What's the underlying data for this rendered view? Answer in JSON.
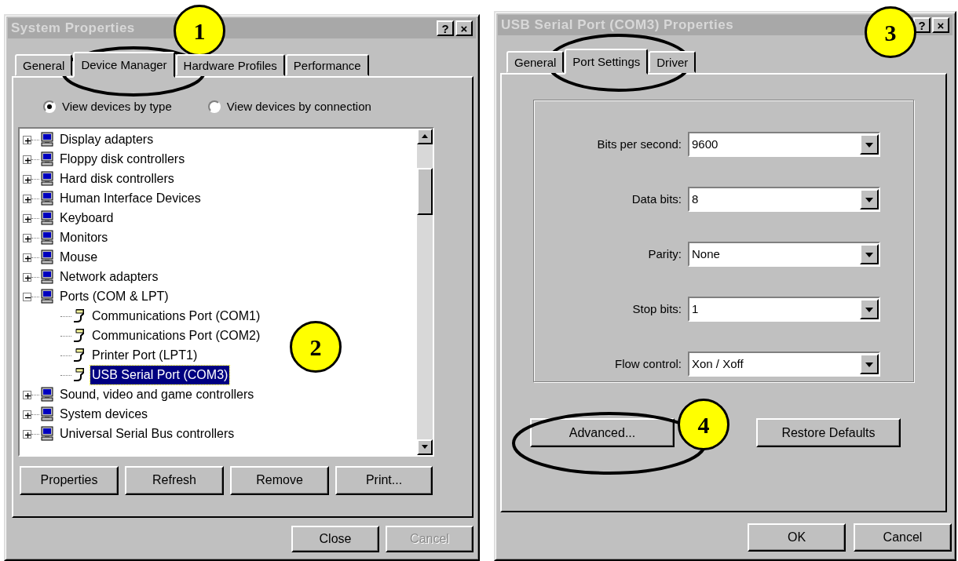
{
  "system_properties": {
    "title": "System Properties",
    "title_buttons": [
      "?",
      "×"
    ],
    "tabs": [
      {
        "label": "General",
        "selected": false
      },
      {
        "label": "Device Manager",
        "selected": true
      },
      {
        "label": "Hardware Profiles",
        "selected": false
      },
      {
        "label": "Performance",
        "selected": false
      }
    ],
    "view_options": [
      {
        "label": "View devices by type",
        "selected": true
      },
      {
        "label": "View devices by connection",
        "selected": false
      }
    ],
    "device_tree": [
      {
        "label": "Display adapters",
        "expanded": false,
        "selected": false
      },
      {
        "label": "Floppy disk controllers",
        "expanded": false,
        "selected": false
      },
      {
        "label": "Hard disk controllers",
        "expanded": false,
        "selected": false
      },
      {
        "label": "Human Interface Devices",
        "expanded": false,
        "selected": false
      },
      {
        "label": "Keyboard",
        "expanded": false,
        "selected": false
      },
      {
        "label": "Monitors",
        "expanded": false,
        "selected": false
      },
      {
        "label": "Mouse",
        "expanded": false,
        "selected": false
      },
      {
        "label": "Network adapters",
        "expanded": false,
        "selected": false
      },
      {
        "label": "Ports (COM & LPT)",
        "expanded": true,
        "selected": false,
        "children": [
          {
            "label": "Communications Port (COM1)",
            "selected": false
          },
          {
            "label": "Communications Port (COM2)",
            "selected": false
          },
          {
            "label": "Printer Port (LPT1)",
            "selected": false
          },
          {
            "label": "USB Serial Port (COM3)",
            "selected": true
          }
        ]
      },
      {
        "label": "Sound, video and game controllers",
        "expanded": false,
        "selected": false
      },
      {
        "label": "System devices",
        "expanded": false,
        "selected": false
      },
      {
        "label": "Universal Serial Bus controllers",
        "expanded": false,
        "selected": false
      }
    ],
    "tree_buttons": [
      {
        "label": "Properties",
        "disabled": false
      },
      {
        "label": "Refresh",
        "disabled": false
      },
      {
        "label": "Remove",
        "disabled": false
      },
      {
        "label": "Print...",
        "disabled": false
      }
    ],
    "dialog_buttons": [
      {
        "label": "Close",
        "disabled": false
      },
      {
        "label": "Cancel",
        "disabled": true
      }
    ]
  },
  "port_properties": {
    "title": "USB Serial Port (COM3) Properties",
    "title_buttons": [
      "?",
      "×"
    ],
    "tabs": [
      {
        "label": "General",
        "selected": false
      },
      {
        "label": "Port Settings",
        "selected": true
      },
      {
        "label": "Driver",
        "selected": false
      }
    ],
    "settings": [
      {
        "label": "Bits per second:",
        "value": "9600"
      },
      {
        "label": "Data bits:",
        "value": "8"
      },
      {
        "label": "Parity:",
        "value": "None"
      },
      {
        "label": "Stop bits:",
        "value": "1"
      },
      {
        "label": "Flow control:",
        "value": "Xon / Xoff"
      }
    ],
    "panel_buttons": [
      {
        "label": "Advanced...",
        "disabled": false
      },
      {
        "label": "Restore Defaults",
        "disabled": false
      }
    ],
    "dialog_buttons": [
      {
        "label": "OK",
        "disabled": false
      },
      {
        "label": "Cancel",
        "disabled": false
      }
    ]
  },
  "callouts": [
    "1",
    "2",
    "3",
    "4"
  ]
}
